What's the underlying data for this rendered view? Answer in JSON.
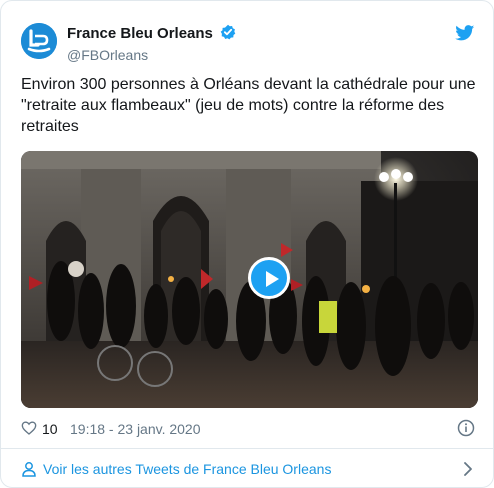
{
  "account": {
    "name": "France Bleu Orleans",
    "handle": "@FBOrleans"
  },
  "tweet": {
    "text": "Environ 300 personnes à Orléans devant la cathédrale pour une \"retraite aux flambeaux\" (jeu de mots) contre la réforme des retraites",
    "likes": "10",
    "timestamp": "19:18 - 23 janv. 2020"
  },
  "footer": {
    "link_text": "Voir les autres Tweets de France Bleu Orleans"
  },
  "colors": {
    "accent": "#1da1f2",
    "link": "#1b95e0",
    "secondary_text": "#657786"
  },
  "icons": {
    "verified": "verified-badge-icon",
    "brand": "twitter-bird-icon",
    "media_action": "play-icon"
  }
}
